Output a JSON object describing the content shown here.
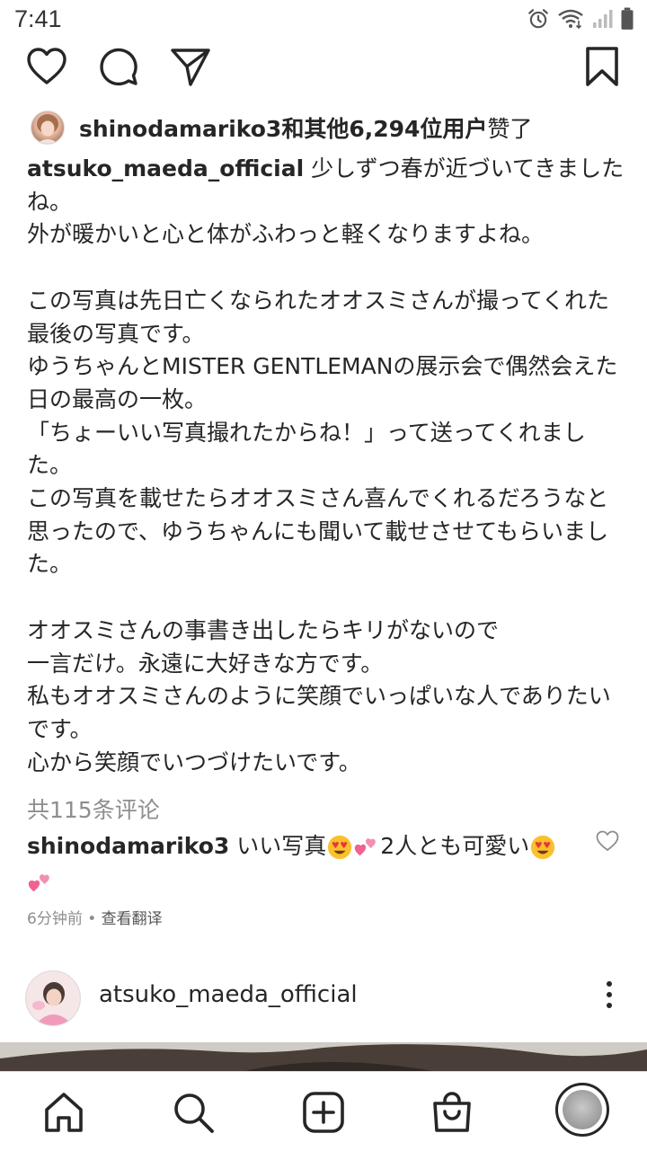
{
  "status_bar": {
    "time": "7:41"
  },
  "likes": {
    "user": "shinodamariko3",
    "count_text": "和其他6,294位用户",
    "suffix": "赞了"
  },
  "caption": {
    "username": "atsuko_maeda_official",
    "text": " 少しずつ春が近づいてきましたね。\n外が暖かいと心と体がふわっと軽くなりますよね。\n\nこの写真は先日亡くなられたオオスミさんが撮ってくれた最後の写真です。\nゆうちゃんとMISTER GENTLEMANの展示会で偶然会えた日の最高の一枚。\n「ちょーいい写真撮れたからね！」って送ってくれました。\nこの写真を載せたらオオスミさん喜んでくれるだろうなと思ったので、ゆうちゃんにも聞いて載せさせてもらいました。\n\nオオスミさんの事書き出したらキリがないので\n一言だけ。永遠に大好きな方です。\n私もオオスミさんのように笑顔でいっぱいな人でありたいです。\n心から笑顔でいつづけたいです。"
  },
  "comments": {
    "count_text": "共115条评论",
    "items": [
      {
        "username": "shinodamariko3",
        "text_1": " いい写真",
        "text_2": "2人とも可愛い",
        "time": "6分钟前",
        "separator": " • ",
        "translate": "查看翻译"
      }
    ]
  },
  "next_post": {
    "username": "atsuko_maeda_official"
  },
  "icons": {
    "like": "heart-outline-icon",
    "comment": "comment-bubble-icon",
    "share": "paper-plane-icon",
    "save": "bookmark-icon",
    "more": "more-vertical-icon",
    "nav_home": "home-icon",
    "nav_search": "search-icon",
    "nav_new": "new-post-icon",
    "nav_shop": "shop-bag-icon",
    "nav_profile": "profile-avatar"
  },
  "colors": {
    "text": "#262626",
    "secondary_text": "#8e8e8e",
    "emoji_heart_eyes": "#fbc02d",
    "emoji_hearts": "#f06292"
  }
}
